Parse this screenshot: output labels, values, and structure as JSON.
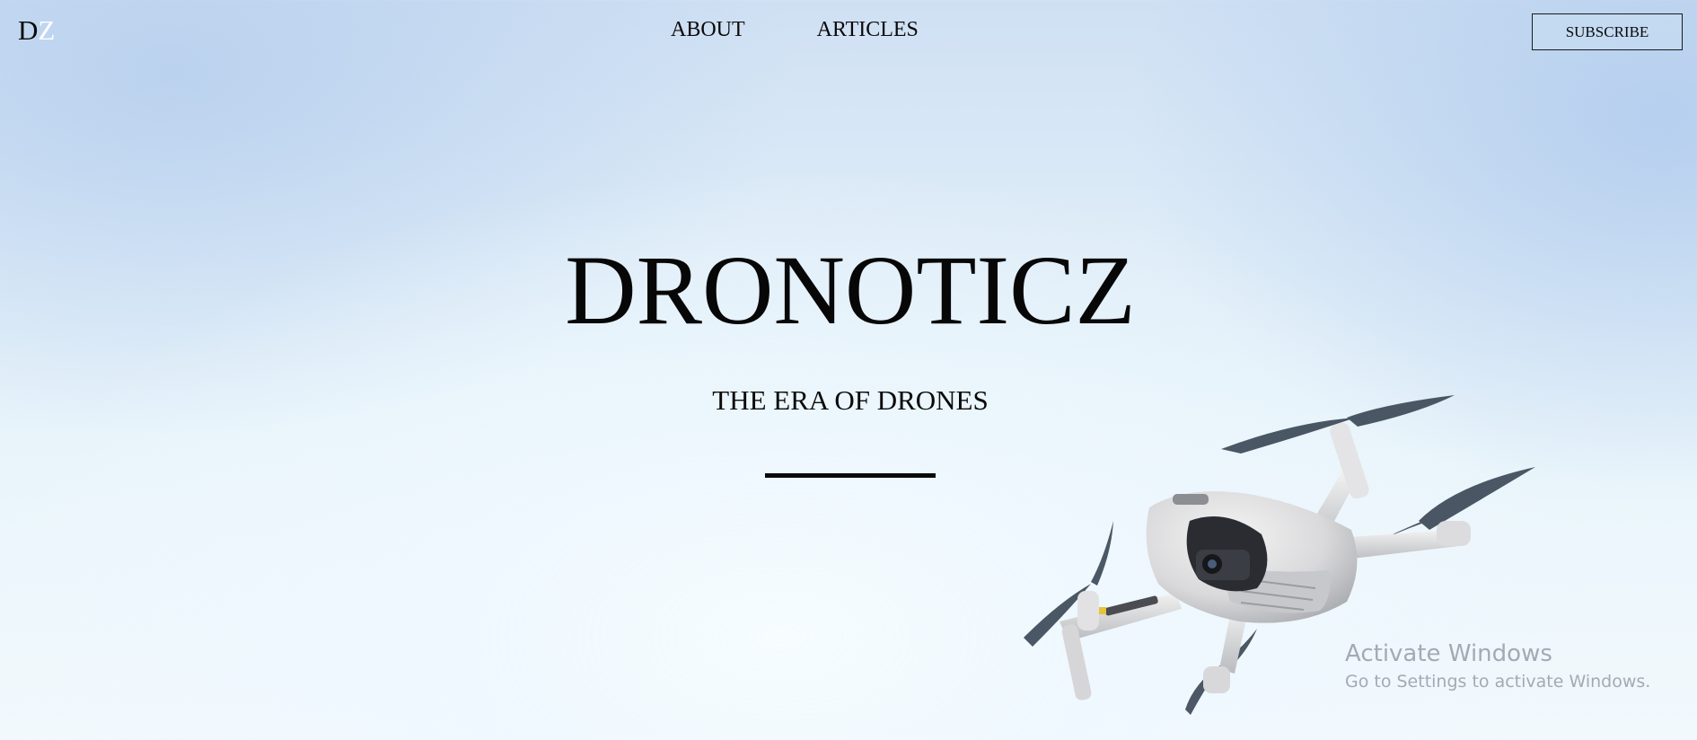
{
  "logo": {
    "letter_1": "D",
    "letter_2": "Z"
  },
  "nav": {
    "items": [
      {
        "label": "ABOUT"
      },
      {
        "label": "ARTICLES"
      }
    ]
  },
  "header": {
    "subscribe_label": "SUBSCRIBE"
  },
  "hero": {
    "title": "DRONOTICZ",
    "subtitle": "THE ERA OF DRONES"
  },
  "illustration": {
    "icon": "drone-icon"
  },
  "os_watermark": {
    "title": "Activate Windows",
    "subtitle": "Go to Settings to activate Windows."
  },
  "colors": {
    "text": "#0a0a0a",
    "sky_top": "#cfe0f3",
    "sky_bottom": "#f2f9fd",
    "logo_accent": "#ffffff"
  }
}
